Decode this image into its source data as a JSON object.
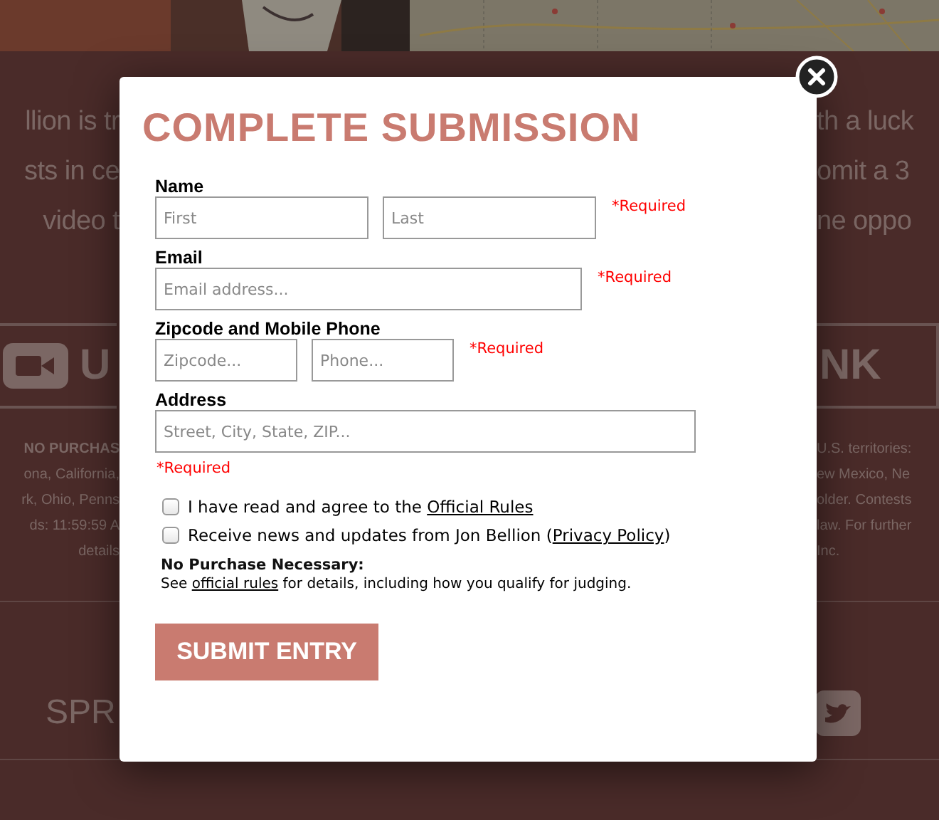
{
  "background": {
    "headline_left": [
      "llion is tr",
      "sts in ce",
      "video t"
    ],
    "headline_right": [
      "th a luck",
      "omit a 3",
      "ne oppo"
    ],
    "share_left": "U",
    "share_right": "NK",
    "fine_print_left": [
      {
        "text": "NO PURCHAS",
        "bold": true
      },
      {
        "text": "ona, California,",
        "bold": false
      },
      {
        "text": "rk, Ohio, Penns",
        "bold": false
      },
      {
        "text": "ds: 11:59:59 A",
        "bold": false
      },
      {
        "text": "details",
        "bold": false
      }
    ],
    "fine_print_right": [
      "U.S. territories:",
      "ew Mexico, Ne",
      "older. Contests",
      "law. For further",
      "Inc."
    ],
    "footer_left": "SPR"
  },
  "dialog": {
    "title": "COMPLETE SUBMISSION",
    "fields": [
      {
        "label": "Name",
        "inputs": [
          {
            "placeholder": "First"
          },
          {
            "placeholder": "Last"
          }
        ],
        "note": "*Required"
      },
      {
        "label": "Email",
        "inputs": [
          {
            "placeholder": "Email address..."
          }
        ],
        "note": "*Required"
      },
      {
        "label": "Zipcode and Mobile Phone",
        "inputs": [
          {
            "placeholder": "Zipcode..."
          },
          {
            "placeholder": "Phone..."
          }
        ],
        "note": "*Required"
      },
      {
        "label": "Address",
        "inputs": [
          {
            "placeholder": "Street, City, State, ZIP..."
          }
        ],
        "note": "*Required"
      }
    ],
    "checkboxes": [
      {
        "before": "I have read and agree to the ",
        "link": "Official Rules",
        "checked": false
      },
      {
        "before": "Receive news and updates from Jon Bellion (",
        "link": "Privacy Policy",
        "after": ")",
        "checked": false
      }
    ],
    "notice_heading": "No Purchase Necessary:",
    "notice": {
      "before": "See ",
      "link": "official rules",
      "after": " for details, including how you qualify for judging."
    },
    "submit": "SUBMIT ENTRY"
  }
}
